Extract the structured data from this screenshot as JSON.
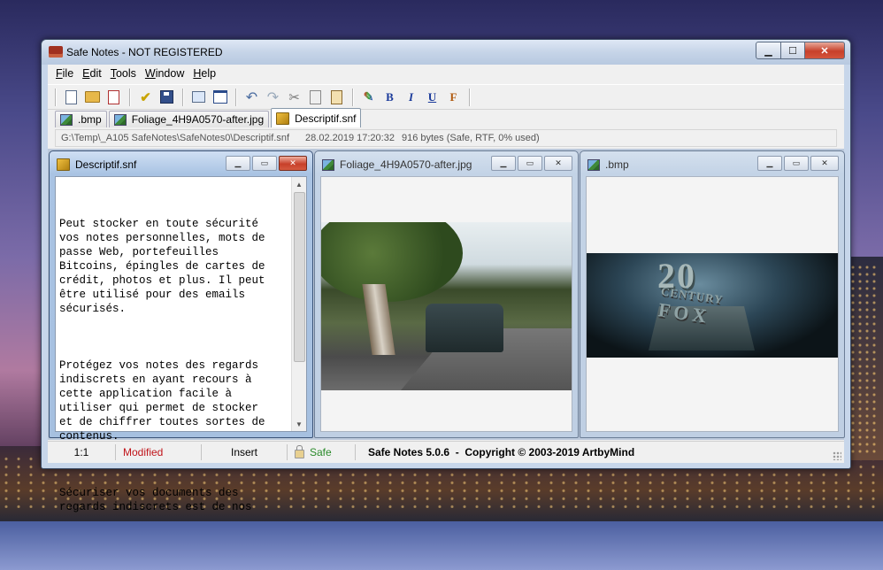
{
  "window": {
    "title": "Safe Notes - NOT REGISTERED",
    "controls": {
      "minimize": "▁",
      "maximize": "☐",
      "close": "✕"
    }
  },
  "menu": [
    {
      "label": "File",
      "accel": "F",
      "rest": "ile"
    },
    {
      "label": "Edit",
      "accel": "E",
      "rest": "dit"
    },
    {
      "label": "Tools",
      "accel": "T",
      "rest": "ools"
    },
    {
      "label": "Window",
      "accel": "W",
      "rest": "indow"
    },
    {
      "label": "Help",
      "accel": "H",
      "rest": "elp"
    }
  ],
  "toolbar": {
    "icons": [
      "new-note-icon",
      "open-icon",
      "close-note-icon",
      "spellcheck-icon",
      "save-icon",
      "new-window-icon",
      "window-icon",
      "undo-icon",
      "redo-icon",
      "cut-icon",
      "copy-icon",
      "paste-icon",
      "color-icon",
      "bold-icon",
      "italic-icon",
      "underline-icon",
      "font-icon"
    ],
    "bold": "B",
    "italic": "I",
    "underline": "U",
    "font": "F"
  },
  "tabs": [
    {
      "label": ".bmp",
      "type": "image",
      "active": false
    },
    {
      "label": "Foliage_4H9A0570-after.jpg",
      "type": "image",
      "active": false
    },
    {
      "label": "Descriptif.snf",
      "type": "note",
      "active": true
    }
  ],
  "pathbar": {
    "path": "G:\\Temp\\_A105 SafeNotes\\SafeNotes0\\Descriptif.snf",
    "date": "28.02.2019 17:20:32",
    "info": "916 bytes (Safe, RTF, 0% used)"
  },
  "children": [
    {
      "title": "Descriptif.snf",
      "type": "note",
      "active": true,
      "paragraphs": [
        "Peut stocker en toute sécurité\nvos notes personnelles, mots de\npasse Web, portefeuilles\nBitcoins, épingles de cartes de\ncrédit, photos et plus. Il peut\nêtre utilisé pour des emails\nsécurisés.",
        "Protégez vos notes des regards\nindiscrets en ayant recours à\ncette application facile à\nutiliser qui permet de stocker\net de chiffrer toutes sortes de\ncontenus.",
        "Sécuriser vos documents des\nregards indiscrets est de nos"
      ]
    },
    {
      "title": "Foliage_4H9A0570-after.jpg",
      "type": "image",
      "active": false
    },
    {
      "title": ".bmp",
      "type": "image",
      "active": false,
      "image_text": [
        "20",
        "CENTURY",
        "FOX"
      ]
    }
  ],
  "statusbar": {
    "position": "1:1",
    "modified": "Modified",
    "mode": "Insert",
    "safe": "Safe",
    "copyright": "Safe Notes 5.0.6  -  Copyright © 2003-2019 ArtbyMind"
  },
  "colors": {
    "modified": "#c0141a",
    "safe": "#2b8a2b",
    "close_button": "#c7402a"
  }
}
